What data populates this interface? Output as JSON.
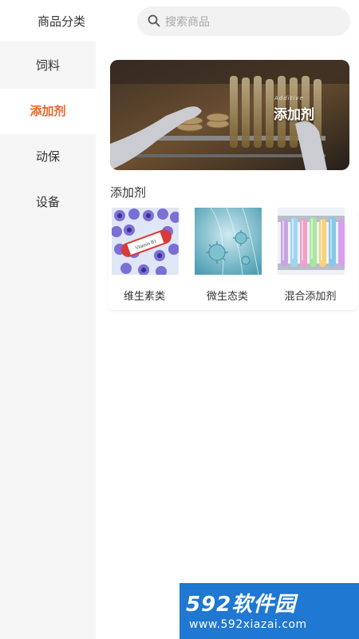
{
  "header": {
    "title": "商品分类",
    "search_placeholder": "搜索商品"
  },
  "sidebar": {
    "items": [
      {
        "label": "饲料",
        "active": false
      },
      {
        "label": "添加剂",
        "active": true
      },
      {
        "label": "动保",
        "active": false
      },
      {
        "label": "设备",
        "active": false
      }
    ]
  },
  "main": {
    "banner": {
      "caption_small": "Additive",
      "caption": "添加剂"
    },
    "section_title": "添加剂",
    "products": [
      {
        "label": "维生素类",
        "image": "vitamin-tubes-image"
      },
      {
        "label": "微生态类",
        "image": "microbe-image"
      },
      {
        "label": "混合添加剂",
        "image": "test-tubes-image"
      }
    ]
  },
  "watermark": {
    "brand": "592软件园",
    "url": "www.592xiazai.com"
  },
  "colors": {
    "accent": "#e8662b",
    "sidebar_bg": "#f5f5f5",
    "watermark_bg": "#1f78d1"
  }
}
